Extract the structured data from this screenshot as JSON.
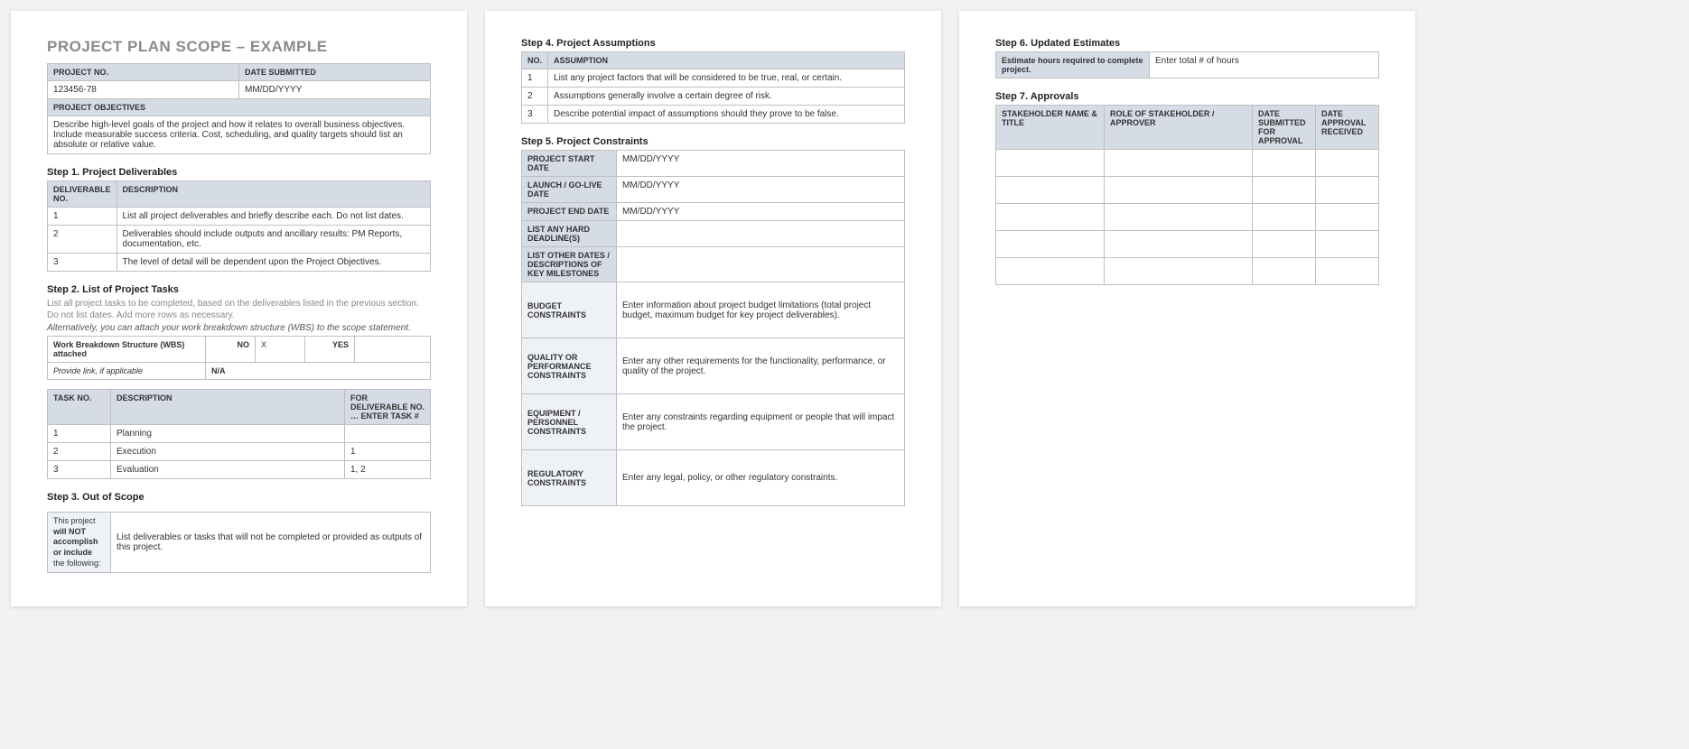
{
  "title": "PROJECT PLAN SCOPE – EXAMPLE",
  "info": {
    "projectNoHeader": "PROJECT NO.",
    "dateSubmittedHeader": "DATE SUBMITTED",
    "projectNo": "123456-78",
    "dateSubmitted": "MM/DD/YYYY",
    "objectivesHeader": "PROJECT OBJECTIVES",
    "objectivesBody": "Describe high-level goals of the project and how it relates to overall business objectives.  Include measurable success criteria.  Cost, scheduling, and quality targets should list an absolute or relative value."
  },
  "step1": {
    "heading": "Step 1. Project Deliverables",
    "cols": {
      "no": "DELIVERABLE NO.",
      "desc": "DESCRIPTION"
    },
    "rows": [
      {
        "no": "1",
        "desc": "List all project deliverables and briefly describe each. Do not list dates."
      },
      {
        "no": "2",
        "desc": "Deliverables should include outputs and ancillary results: PM Reports, documentation, etc."
      },
      {
        "no": "3",
        "desc": "The level of detail will be dependent upon the Project Objectives."
      }
    ]
  },
  "step2": {
    "heading": "Step 2. List of Project Tasks",
    "note1": "List all project tasks to be completed, based on the deliverables listed in the previous section. Do not list dates. Add more rows as necessary.",
    "note2": "Alternatively, you can attach your work breakdown structure (WBS) to the scope statement.",
    "wbs": {
      "label": "Work Breakdown Structure (WBS) attached",
      "no": "NO",
      "noVal": "X",
      "yes": "YES",
      "yesVal": "",
      "linkLabel": "Provide link, if applicable",
      "linkVal": "N/A"
    },
    "cols": {
      "no": "TASK NO.",
      "desc": "DESCRIPTION",
      "for": "FOR DELIVERABLE NO. … ENTER TASK #"
    },
    "rows": [
      {
        "no": "1",
        "desc": "Planning",
        "for": ""
      },
      {
        "no": "2",
        "desc": "Execution",
        "for": "1"
      },
      {
        "no": "3",
        "desc": "Evaluation",
        "for": "1, 2"
      }
    ]
  },
  "step3": {
    "heading": "Step 3. Out of Scope",
    "sideA": "This project ",
    "sideB": "will NOT accomplish or include",
    "sideC": " the following:",
    "body": "List deliverables or tasks that will not be completed or provided as outputs of this project."
  },
  "step4": {
    "heading": "Step 4. Project Assumptions",
    "cols": {
      "no": "NO.",
      "assume": "ASSUMPTION"
    },
    "rows": [
      {
        "no": "1",
        "assume": "List any project factors that will be considered to be true, real, or certain."
      },
      {
        "no": "2",
        "assume": "Assumptions generally involve a certain degree of risk."
      },
      {
        "no": "3",
        "assume": "Describe potential impact of assumptions should they prove to be false."
      }
    ]
  },
  "step5": {
    "heading": "Step 5. Project Constraints",
    "dates": {
      "start": {
        "label": "PROJECT START DATE",
        "val": "MM/DD/YYYY"
      },
      "golive": {
        "label": "LAUNCH / GO-LIVE DATE",
        "val": "MM/DD/YYYY"
      },
      "end": {
        "label": "PROJECT END DATE",
        "val": "MM/DD/YYYY"
      },
      "hard": {
        "label": "LIST ANY HARD DEADLINE(S)",
        "val": ""
      },
      "other": {
        "label": "LIST OTHER DATES / DESCRIPTIONS OF KEY MILESTONES",
        "val": ""
      }
    },
    "blocks": {
      "budget": {
        "label": "BUDGET CONSTRAINTS",
        "val": "Enter information about project budget limitations (total project budget, maximum budget for key project deliverables)."
      },
      "quality": {
        "label": "QUALITY OR PERFORMANCE CONSTRAINTS",
        "val": "Enter any other requirements for the functionality, performance, or quality of the project."
      },
      "equip": {
        "label": "EQUIPMENT / PERSONNEL CONSTRAINTS",
        "val": "Enter any constraints regarding equipment or people that will impact the project."
      },
      "reg": {
        "label": "REGULATORY CONSTRAINTS",
        "val": "Enter any legal, policy, or other regulatory constraints."
      }
    }
  },
  "step6": {
    "heading": "Step 6. Updated Estimates",
    "label": "Estimate hours required to complete project.",
    "val": "Enter total # of hours"
  },
  "step7": {
    "heading": "Step 7. Approvals",
    "cols": {
      "name": "STAKEHOLDER NAME & TITLE",
      "role": "ROLE OF STAKEHOLDER / APPROVER",
      "submitted": "DATE SUBMITTED FOR APPROVAL",
      "received": "DATE APPROVAL RECEIVED"
    }
  }
}
